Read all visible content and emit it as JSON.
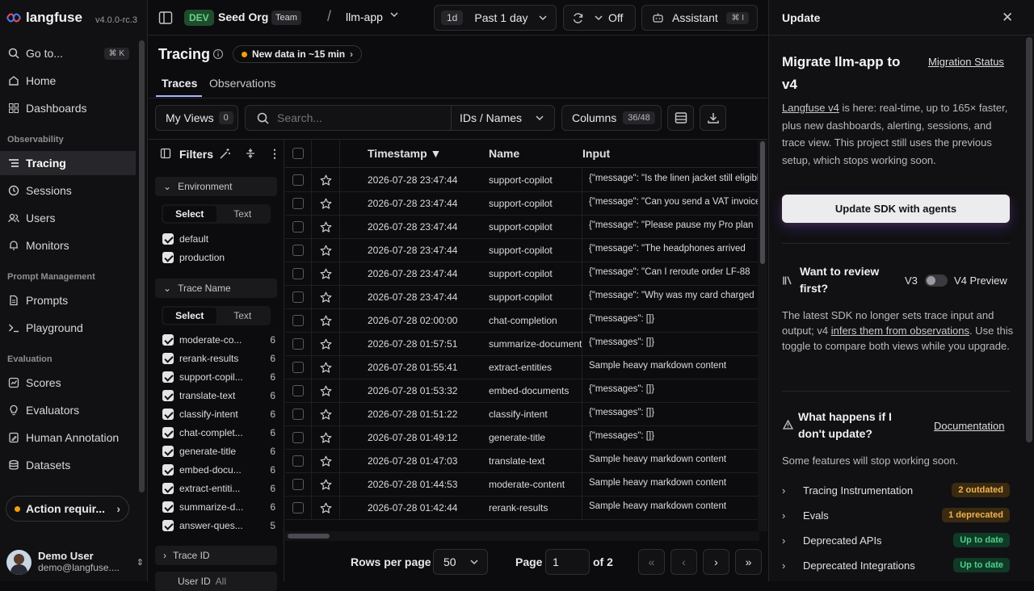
{
  "app": {
    "logo_text": "langfuse",
    "version": "v4.0.0-rc.3"
  },
  "sidebar": {
    "goto": {
      "label": "Go to...",
      "shortcut": "⌘ K"
    },
    "top_items": [
      {
        "label": "Home",
        "icon": "home-icon"
      },
      {
        "label": "Dashboards",
        "icon": "grid-icon"
      }
    ],
    "sections": [
      {
        "title": "Observability",
        "items": [
          {
            "label": "Tracing",
            "icon": "list-icon",
            "active": true
          },
          {
            "label": "Sessions",
            "icon": "clock-icon"
          },
          {
            "label": "Users",
            "icon": "users-icon"
          },
          {
            "label": "Monitors",
            "icon": "bell-icon"
          }
        ]
      },
      {
        "title": "Prompt Management",
        "items": [
          {
            "label": "Prompts",
            "icon": "file-icon"
          },
          {
            "label": "Playground",
            "icon": "terminal-icon"
          }
        ]
      },
      {
        "title": "Evaluation",
        "items": [
          {
            "label": "Scores",
            "icon": "scores-icon"
          },
          {
            "label": "Evaluators",
            "icon": "bulb-icon"
          },
          {
            "label": "Human Annotation",
            "icon": "annotation-icon"
          },
          {
            "label": "Datasets",
            "icon": "database-icon"
          }
        ]
      }
    ],
    "action_required": "Action requir...",
    "user": {
      "name": "Demo User",
      "email": "demo@langfuse...."
    }
  },
  "topbar": {
    "env_badge": "DEV",
    "org": "Seed Org",
    "team_badge": "Team",
    "project": "llm-app",
    "time_short": "1d",
    "time_label": "Past 1 day",
    "refresh_label": "Off",
    "assistant_label": "Assistant",
    "assistant_shortcut": "⌘ I"
  },
  "page": {
    "title": "Tracing",
    "new_data": "New data in ~15 min",
    "tabs": [
      "Traces",
      "Observations"
    ],
    "my_views": "My Views",
    "my_views_count": "0",
    "search_placeholder": "Search...",
    "search_mode": "IDs / Names",
    "columns_label": "Columns",
    "columns_count": "36/48"
  },
  "filters": {
    "title": "Filters",
    "environment": {
      "title": "Environment",
      "tab_select": "Select",
      "tab_text": "Text",
      "options": [
        "default",
        "production"
      ]
    },
    "trace_name": {
      "title": "Trace Name",
      "tab_select": "Select",
      "tab_text": "Text",
      "options": [
        {
          "label": "moderate-co...",
          "count": "6"
        },
        {
          "label": "rerank-results",
          "count": "6"
        },
        {
          "label": "support-copil...",
          "count": "6"
        },
        {
          "label": "translate-text",
          "count": "6"
        },
        {
          "label": "classify-intent",
          "count": "6"
        },
        {
          "label": "chat-complet...",
          "count": "6"
        },
        {
          "label": "generate-title",
          "count": "6"
        },
        {
          "label": "embed-docu...",
          "count": "6"
        },
        {
          "label": "extract-entiti...",
          "count": "6"
        },
        {
          "label": "summarize-d...",
          "count": "6"
        },
        {
          "label": "answer-ques...",
          "count": "5"
        }
      ]
    },
    "trace_id": "Trace ID",
    "user_id": "User ID",
    "user_id_value": "All"
  },
  "table": {
    "headers": {
      "timestamp": "Timestamp ▼",
      "name": "Name",
      "input": "Input"
    },
    "rows": [
      {
        "ts": "2026-07-28 23:47:44",
        "name": "support-copilot",
        "input": "{\"message\": \"Is the linen jacket still eligible"
      },
      {
        "ts": "2026-07-28 23:47:44",
        "name": "support-copilot",
        "input": "{\"message\": \"Can you send a VAT invoice"
      },
      {
        "ts": "2026-07-28 23:47:44",
        "name": "support-copilot",
        "input": "{\"message\": \"Please pause my Pro plan"
      },
      {
        "ts": "2026-07-28 23:47:44",
        "name": "support-copilot",
        "input": "{\"message\": \"The headphones arrived"
      },
      {
        "ts": "2026-07-28 23:47:44",
        "name": "support-copilot",
        "input": "{\"message\": \"Can I reroute order LF-88"
      },
      {
        "ts": "2026-07-28 23:47:44",
        "name": "support-copilot",
        "input": "{\"message\": \"Why was my card charged"
      },
      {
        "ts": "2026-07-28 02:00:00",
        "name": "chat-completion",
        "input": "{\"messages\": []}"
      },
      {
        "ts": "2026-07-28 01:57:51",
        "name": "summarize-document",
        "input": "{\"messages\": []}"
      },
      {
        "ts": "2026-07-28 01:55:41",
        "name": "extract-entities",
        "input": "Sample heavy markdown content"
      },
      {
        "ts": "2026-07-28 01:53:32",
        "name": "embed-documents",
        "input": "{\"messages\": []}"
      },
      {
        "ts": "2026-07-28 01:51:22",
        "name": "classify-intent",
        "input": "{\"messages\": []}"
      },
      {
        "ts": "2026-07-28 01:49:12",
        "name": "generate-title",
        "input": "{\"messages\": []}"
      },
      {
        "ts": "2026-07-28 01:47:03",
        "name": "translate-text",
        "input": "Sample heavy markdown content"
      },
      {
        "ts": "2026-07-28 01:44:53",
        "name": "moderate-content",
        "input": "Sample heavy markdown content"
      },
      {
        "ts": "2026-07-28 01:42:44",
        "name": "rerank-results",
        "input": "Sample heavy markdown content"
      }
    ],
    "pagination": {
      "rows_per_page_label": "Rows per page",
      "rows_per_page": "50",
      "page_label": "Page",
      "page": "1",
      "of_label": "of 2"
    }
  },
  "panel": {
    "header": "Update",
    "title": "Migrate llm-app to v4",
    "migration_status": "Migration Status",
    "intro_link": "Langfuse v4",
    "intro_text": " is here: real-time, up to 165× faster, plus new dashboards, alerting, sessions, and trace view. This project still uses the previous setup, which stops working soon.",
    "update_button": "Update SDK with agents",
    "review_title": "Want to review first?",
    "review_v3": "V3",
    "review_v4": "V4 Preview",
    "review_text_1": "The latest SDK no longer sets trace input and output; v4 ",
    "review_link": "infers them from observations",
    "review_text_2": ". Use this toggle to compare both views while you upgrade.",
    "what_title": "What happens if I don't update?",
    "documentation": "Documentation",
    "features_text": "Some features will stop working soon.",
    "items": [
      {
        "label": "Tracing Instrumentation",
        "badge": "2 outdated",
        "kind": "warn"
      },
      {
        "label": "Evals",
        "badge": "1 deprecated",
        "kind": "warn"
      },
      {
        "label": "Deprecated APIs",
        "badge": "Up to date",
        "kind": "ok"
      },
      {
        "label": "Deprecated Integrations",
        "badge": "Up to date",
        "kind": "ok"
      }
    ],
    "colors": {
      "warn_bg": "#3a2a10",
      "warn_fg": "#f0b252",
      "ok_bg": "#0f3a26",
      "ok_fg": "#4fd18b",
      "accent_orange": "#f59e0b"
    }
  }
}
